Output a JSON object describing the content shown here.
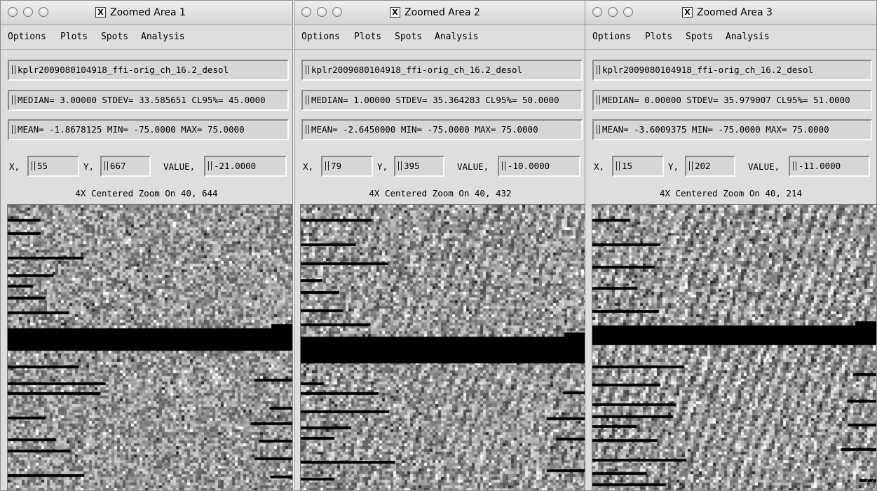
{
  "windows": [
    {
      "title": "Zoomed Area  1",
      "menu": [
        "Options",
        "Plots",
        "Spots",
        "Analysis"
      ],
      "filename": "kplr2009080104918_ffi-orig_ch_16.2_desol",
      "median_line": "MEDIAN= 3.00000 STDEV= 33.585651 CL95%= 45.0000",
      "mean_line": "MEAN= -1.8678125 MIN= -75.0000 MAX= 75.0000",
      "x_label": "X,",
      "x_value": "55",
      "y_label": "Y,",
      "y_value": "667",
      "value_label": "VALUE,",
      "value_value": "-21.0000",
      "zoom_label": "4X Centered Zoom On  40, 644"
    },
    {
      "title": "Zoomed Area  2",
      "menu": [
        "Options",
        "Plots",
        "Spots",
        "Analysis"
      ],
      "filename": "kplr2009080104918_ffi-orig_ch_16.2_desol",
      "median_line": "MEDIAN= 1.00000 STDEV= 35.364283 CL95%= 50.0000",
      "mean_line": "MEAN= -2.6450000 MIN= -75.0000 MAX= 75.0000",
      "x_label": "X,",
      "x_value": "79",
      "y_label": "Y,",
      "y_value": "395",
      "value_label": "VALUE,",
      "value_value": "-10.0000",
      "zoom_label": "4X Centered Zoom On  40, 432"
    },
    {
      "title": "Zoomed Area  3",
      "menu": [
        "Options",
        "Plots",
        "Spots",
        "Analysis"
      ],
      "filename": "kplr2009080104918_ffi-orig_ch_16.2_desol",
      "median_line": "MEDIAN= 0.00000 STDEV= 35.979007 CL95%= 51.0000",
      "mean_line": "MEAN= -3.6009375 MIN= -75.0000 MAX= 75.0000",
      "x_label": "X,",
      "x_value": "15",
      "y_label": "Y,",
      "y_value": "202",
      "value_label": "VALUE,",
      "value_value": "-11.0000",
      "zoom_label": "4X Centered Zoom On  40, 214"
    }
  ],
  "icons": {
    "traffic_lights": "circle-buttons",
    "title_glyph": "x11-icon",
    "text_cursor": "ibeam-cursor-icon",
    "resize": "resize-grip-icon"
  },
  "colors": {
    "window_bg": "#dedede",
    "black": "#000000"
  }
}
